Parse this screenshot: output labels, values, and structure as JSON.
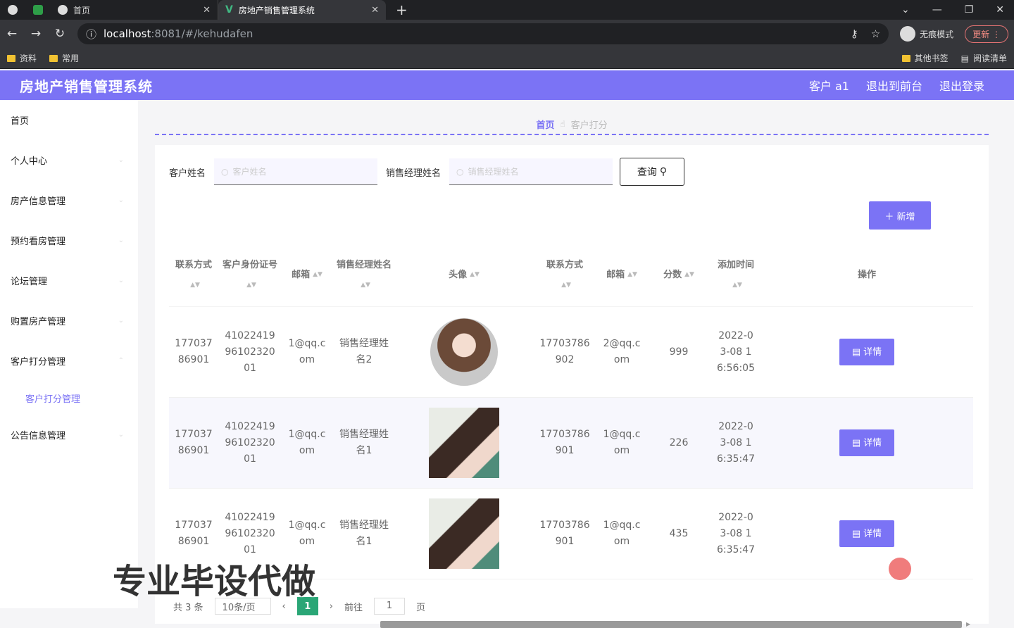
{
  "browser": {
    "tabs": [
      {
        "label": "首页"
      },
      {
        "label": "房地产销售管理系统"
      }
    ],
    "address": {
      "host": "localhost",
      "path": ":8081/#/kehudafen"
    },
    "incognito_label": "无痕模式",
    "update_label": "更新",
    "bookmarks": [
      {
        "label": "资料"
      },
      {
        "label": "常用"
      }
    ],
    "bookmarks_right": [
      {
        "label": "其他书签"
      },
      {
        "label": "阅读清单"
      }
    ]
  },
  "header": {
    "title": "房地产销售管理系统",
    "user": "客户 a1",
    "back_front": "退出到前台",
    "logout": "退出登录"
  },
  "sidebar": {
    "items": [
      {
        "label": "首页"
      },
      {
        "label": "个人中心"
      },
      {
        "label": "房产信息管理"
      },
      {
        "label": "预约看房管理"
      },
      {
        "label": "论坛管理"
      },
      {
        "label": "购置房产管理"
      },
      {
        "label": "客户打分管理"
      }
    ],
    "sub_item": "客户打分管理",
    "last_item": "公告信息管理"
  },
  "breadcrumb": {
    "home": "首页",
    "current": "客户打分"
  },
  "search": {
    "name_label": "客户姓名",
    "name_placeholder": "客户姓名",
    "manager_label": "销售经理姓名",
    "manager_placeholder": "销售经理姓名",
    "query_label": "查询"
  },
  "add_label": "＋ 新增",
  "table": {
    "headers": [
      "联系方式",
      "客户身份证号",
      "邮箱",
      "销售经理姓名",
      "头像",
      "联系方式",
      "邮箱",
      "分数",
      "添加时间",
      "操作"
    ],
    "detail_label": "详情",
    "rows": [
      {
        "phone": "17703786901",
        "id": "410224199610232001",
        "email": "1@qq.com",
        "manager": "销售经理姓名2",
        "mphone": "17703786902",
        "memail": "2@qq.com",
        "score": "999",
        "time": "2022-03-08 16:56:05",
        "avatar": "avatar1"
      },
      {
        "phone": "17703786901",
        "id": "410224199610232001",
        "email": "1@qq.com",
        "manager": "销售经理姓名1",
        "mphone": "17703786901",
        "memail": "1@qq.com",
        "score": "226",
        "time": "2022-03-08 16:35:47",
        "avatar": "avatar2"
      },
      {
        "phone": "17703786901",
        "id": "410224199610232001",
        "email": "1@qq.com",
        "manager": "销售经理姓名1",
        "mphone": "17703786901",
        "memail": "1@qq.com",
        "score": "435",
        "time": "2022-03-08 16:35:47",
        "avatar": "avatar2"
      }
    ]
  },
  "pager": {
    "total": "共 3 条",
    "size": "10条/页",
    "current": "1",
    "goto": "前往",
    "goto_value": "1",
    "page_unit": "页"
  },
  "watermark": "专业毕设代做",
  "colors": {
    "accent": "#7b73f5",
    "pager": "#2aa676"
  }
}
